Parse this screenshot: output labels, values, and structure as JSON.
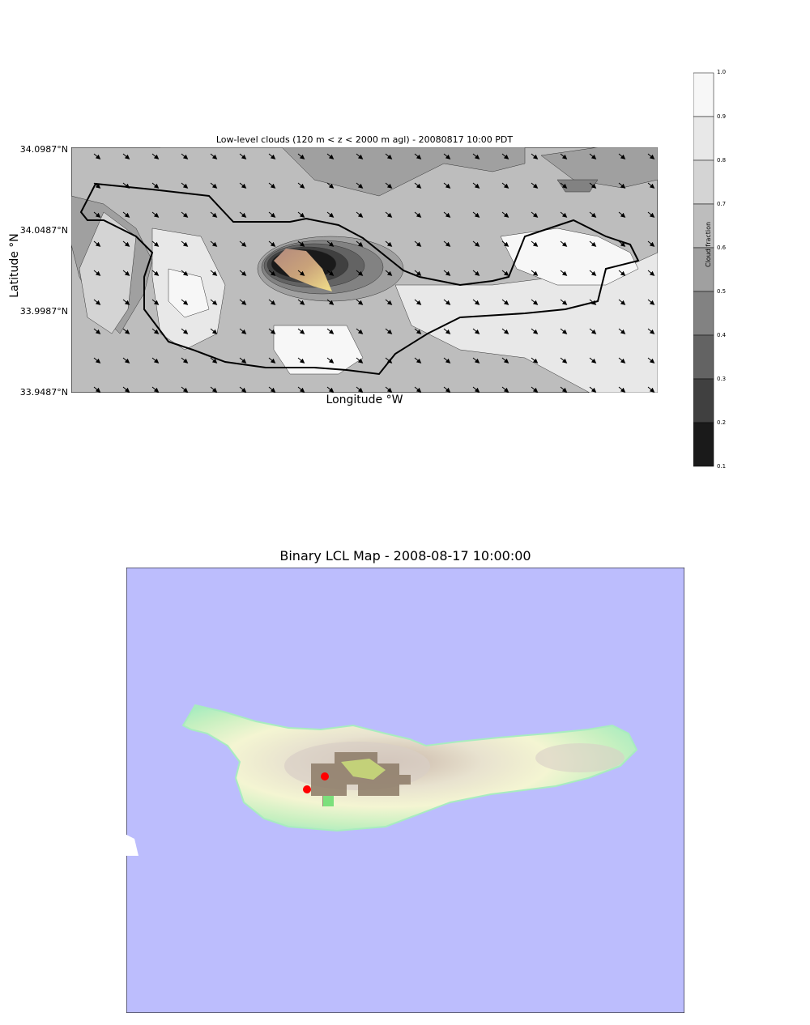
{
  "top_map": {
    "title": "Low-level clouds (120 m < z < 2000 m agl) - 20080817 10:00 PDT",
    "ylabel": "Latitude $^\\circ$N",
    "ylabel_display": "Latitude °N",
    "xlabel_display": "Longitude °W",
    "yticks": [
      "34.0987°N",
      "34.0487°N",
      "33.9987°N",
      "33.9487°N"
    ],
    "colorbar": {
      "label": "Cloud fraction",
      "ticks": [
        "1.0",
        "0.9",
        "0.8",
        "0.7",
        "0.6",
        "0.5",
        "0.4",
        "0.3",
        "0.2",
        "0.1"
      ],
      "colors": [
        "#f7f7f7",
        "#e8e8e8",
        "#d4d4d4",
        "#bdbdbd",
        "#a0a0a0",
        "#828282",
        "#636363",
        "#404040",
        "#1a1a1a"
      ]
    }
  },
  "bottom_map": {
    "title": "Binary LCL Map - 2008-08-17 10:00:00",
    "ocean_color": "#bcbdfd",
    "marker_color": "#ff0000"
  }
}
